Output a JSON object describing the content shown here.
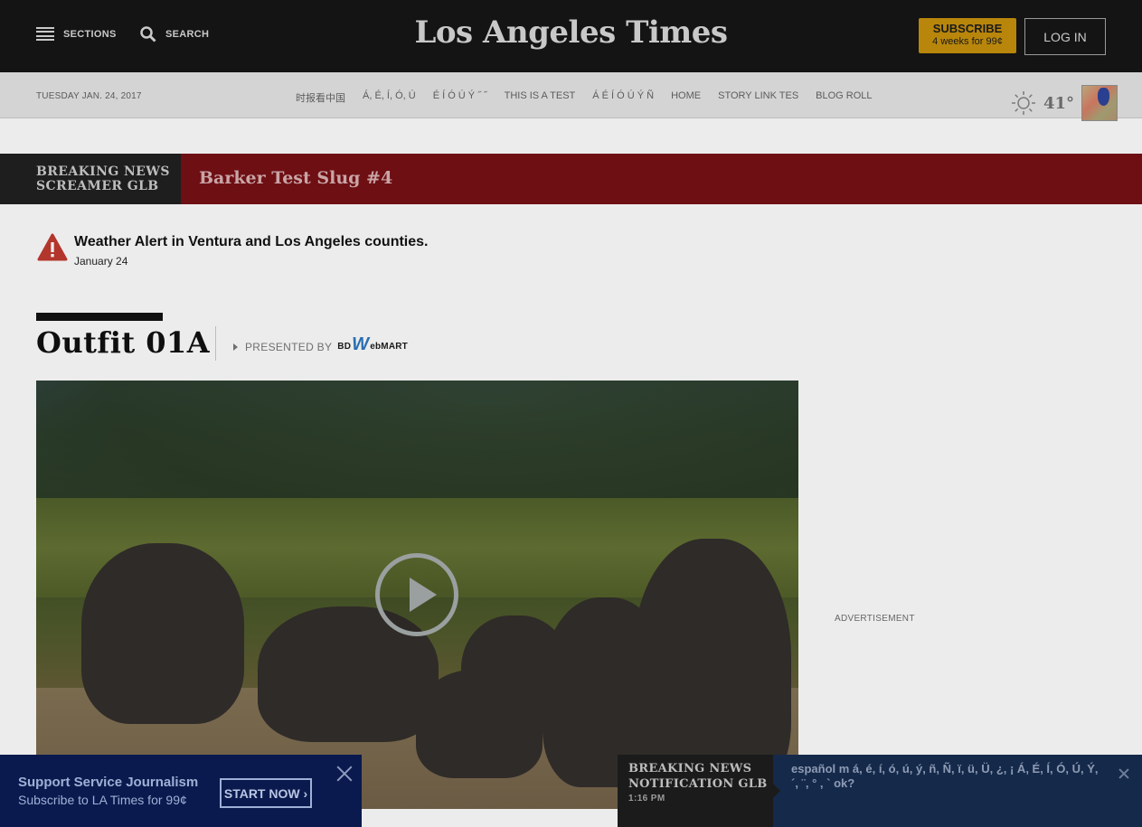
{
  "header": {
    "sections_label": "SECTIONS",
    "search_label": "SEARCH",
    "logo_text": "Los Angeles Times",
    "subscribe_label": "SUBSCRIBE",
    "subscribe_offer": "4 weeks for 99¢",
    "login_label": "LOG IN"
  },
  "subnav": {
    "date": "TUESDAY JAN. 24, 2017",
    "links": [
      "时报看中国",
      "Á, É, Í, Ó, Ú",
      "É Í Ó Ú Ý ˝ ˝",
      "THIS IS A TEST",
      "Á É Í Ó Ú Ý Ñ",
      "HOME",
      "STORY LINK TES",
      "BLOG ROLL"
    ],
    "temperature": "41°",
    "weather_icon": "sun-icon"
  },
  "screamer": {
    "label": "BREAKING NEWS SCREAMER GLB",
    "headline": "Barker Test Slug #4"
  },
  "alert": {
    "title": "Weather Alert in Ventura and Los Angeles counties.",
    "date": "January 24"
  },
  "outfit": {
    "title": "Outfit 01A",
    "presented_by": "PRESENTED BY",
    "sponsor_logo": "BDWebMART"
  },
  "ad": {
    "label": "ADVERTISEMENT"
  },
  "promo": {
    "title": "Support Service Journalism",
    "subtitle": "Subscribe to LA Times for 99¢",
    "button": "START NOW ›"
  },
  "notification": {
    "label": "BREAKING NEWS NOTIFICATION GLB",
    "time": "1:16 PM",
    "text": "español m á, é, í, ó, ú, ý, ñ, Ñ, ï, ü, Ü, ¿, ¡ Á, É, Í, Ó, Ú, Ý, ´, ¨, ° , ` ok?"
  },
  "colors": {
    "header_bg": "#141414",
    "subscribe_bg": "#b8860b",
    "screamer_bg": "#6e0f14",
    "alert_icon": "#c0392b",
    "promo_bg": "#0a1a4e",
    "notification_bg": "#152a4a"
  }
}
